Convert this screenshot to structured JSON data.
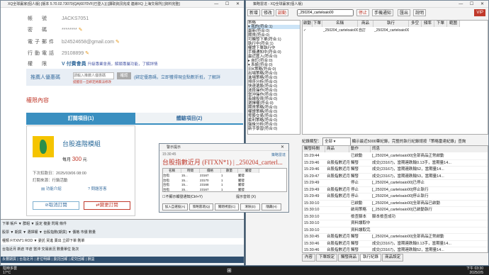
{
  "left_window": {
    "title": "XQ全球贏家(個人版) [版本 5.70.02.73070(QA)6070VF(已登入)] [讀取資訊完成 連線XQ 上海交易所] [資料完整]",
    "tab_title": "XQ 行情 FITXN*1",
    "account_label": "帳　號",
    "account_value": "JACKS7051",
    "password_label": "密　碼",
    "password_value": "********",
    "email_label": "電子郵件",
    "email_value": "b24524658@gmail.com",
    "phone_label": "行動電話",
    "phone_value": "29108899",
    "level_label": "權　限",
    "level_badge": "V 付費會員",
    "level_note": "升級專業會員，解鎖專屬功能，了解詳情",
    "promo_label": "推薦人優惠碼",
    "promo_placeholder": "請輸入推薦人優惠碼",
    "promo_button": "確認",
    "promo_note": "(綁定優惠碼，立即獲得現金點數折抵，了解詳",
    "promo_warning": "提醒您一旦綁定將無法修改",
    "section_title": "權限內容",
    "tab_subscribed": "訂閱項目(1)",
    "tab_trial": "體驗項目(2)",
    "product_name": "台股進階模組",
    "price_prefix": "每月",
    "price_value": "300",
    "price_unit": "元",
    "next_charge": "下次扣款日：2025/03/06 08:00",
    "channel": "訂閱來源：行銷活動",
    "link_intro": "功能介紹",
    "link_faq": "問題答客",
    "cancel_button": "取消訂閱",
    "change_button": "變更訂閱",
    "toolbar_rows": [
      "下單   帳戶  ▼          群組  ▼   設定  複委  閃電  條件",
      "股票 ▼ 期貨 ▼ 選擇權 ▼  台股指數(期貨)  ▼  價格  市價  數量",
      "種類  FITXN*1  ROD  ▼  委託  買進  賣出  立即下單  刪單",
      "台指近月  新倉 平倉  當沖  交易狀況  數量單位  批次",
      "永豐期貨 | 台指近月 | 倉位明細 | 委託回報 | 成交回報 | 損益"
    ]
  },
  "right_window": {
    "title": "策略雷達 - XQ全球贏家(個人版)",
    "toolbar": [
      "新增",
      "修改",
      "啟動",
      "停止",
      "手機通知",
      "匯出",
      "說明"
    ],
    "search_value": "_250204_carteloaio00",
    "vip_badge": "VIP",
    "tree_root": "策略",
    "tree_items": [
      "▾ 我的(符合:1)",
      "  最新(符合:0)",
      "  期貨(符合:0)",
      "  可觸發下單(符合:1)",
      "  執行中(符合:1)",
      "  權證下單執行中",
      "  手機通知中(符合:0)",
      "  最近匯入(符合:0)",
      "▸ 自訂(符合:0)",
      "▾ 系統(符合:0)",
      "  日K策略(符合:0)",
      "  出場策略(符合:0)",
      "  進場策略(符合:0)",
      "  排序分析(符合:0)",
      "  快速選股(符合:0)",
      "  波段操作(符合:0)",
      "  當沖操作(符合:0)",
      "  長線投資(符合:0)",
      "  選擇權(符合:0)",
      "  期貨策略(符合:0)",
      "  權證策略(符合:0)",
      "  零股交易(符合:0)",
      "  套利策略(符合:0)",
      "  盤後分析(符合:0)",
      "  新手學習(符合:0)"
    ],
    "grid_headers": [
      "啟動",
      "下單",
      "名稱",
      "商品",
      "執行",
      "多空",
      "頻率",
      "下單",
      "範圍"
    ],
    "grid_rows": [
      [
        "✓",
        "",
        "_250204_carteloaio00",
        "自訂",
        "_250204_carteloaio00",
        "",
        "",
        "",
        ""
      ]
    ],
    "log_filter_label": "紀錄類型：",
    "log_filter_value": "全部",
    "log_note": "顯示最近5000筆紀錄，完整的執行紀錄請按「策略雷達紀錄」查詢",
    "log_headers": [
      "觸發時間",
      "商品",
      "動作",
      "訊息"
    ],
    "log_rows": [
      [
        "15:29:44",
        "",
        "已啟動",
        "[_250204_carteloaio00]全部商品正常啟動"
      ],
      [
        "15:29:46",
        "台股指數近月",
        "觸發",
        "成交(23167)，當期連跌輸0.13手，當期量14..."
      ],
      [
        "15:29:46",
        "台股指數近月",
        "觸發",
        "成交(23167)，當期連跌輸52，當期量14..."
      ],
      [
        "15:29:47",
        "台股指數近月",
        "觸發",
        "成交(23167)，當期連跌輸53，當期量14..."
      ],
      [
        "15:29:49",
        "",
        "停止",
        "[_250204_carteloaio00]已停止"
      ],
      [
        "15:29:49",
        "台股指數近月",
        "停止",
        "[_250204_carteloaio00]停止執行"
      ],
      [
        "15:29:49",
        "台股指數近月",
        "停止",
        "[_250204_carteloaio00]停止執行"
      ],
      [
        "15:30:10",
        "",
        "已啟動",
        "[_250204_carteloaio00]全部商品已啟動"
      ],
      [
        "15:30:10",
        "",
        "啟用策略",
        "[_250204_carteloaio00]已啟動執行"
      ],
      [
        "15:30:10",
        "",
        "檢查腳本",
        "腳本檢查成功"
      ],
      [
        "15:30:10",
        "",
        "資料讀取中",
        ""
      ],
      [
        "15:30:10",
        "",
        "資料讀取完成",
        ""
      ],
      [
        "15:30:45",
        "台股指數近月",
        "觸發",
        "[_250204_carteloaio00]全部商品正常啟動"
      ],
      [
        "15:30:46",
        "台股指數近月",
        "觸發",
        "成交(23167)，當期連跌輸0.13手，當期量14..."
      ],
      [
        "15:30:46",
        "台股指數近月",
        "觸發",
        "成交(23167)，當期連跌輸52，當期量14..."
      ]
    ],
    "bottom_tabs": [
      "內容",
      "下單設定",
      "觸發商品",
      "執行紀錄",
      "商品設定"
    ]
  },
  "popup": {
    "title": "警示提示",
    "time": "15:30:45",
    "strategy_link": "策略雷達",
    "headline": "台股指數近月 (FITXN*1) | _250204_carterl...",
    "table_headers": [
      "名稱",
      "時間",
      "價格",
      "數量",
      "觸發"
    ],
    "table_rows": [
      [
        "台指",
        "15...",
        "23167",
        "1",
        "觸發"
      ],
      [
        "台指",
        "15...",
        "23170",
        "1",
        "觸發"
      ],
      [
        "台指",
        "15...",
        "23168",
        "1",
        "觸發"
      ],
      [
        "台指",
        "15...",
        "23167",
        "1",
        "觸發"
      ]
    ],
    "checkbox_label": "不顯示觸發通知(Ctrl+Y)",
    "buttons": [
      "加入自選股(A)",
      "策略雷達(Q)",
      "關閉視窗(C)",
      "清除(D)",
      "隱藏(H)"
    ],
    "option_label": "提示音效 (X)"
  },
  "taskbar": {
    "weather": "陰時多雲",
    "temp": "17°C",
    "time": "下午 03:30",
    "date": "2025/2/5"
  }
}
